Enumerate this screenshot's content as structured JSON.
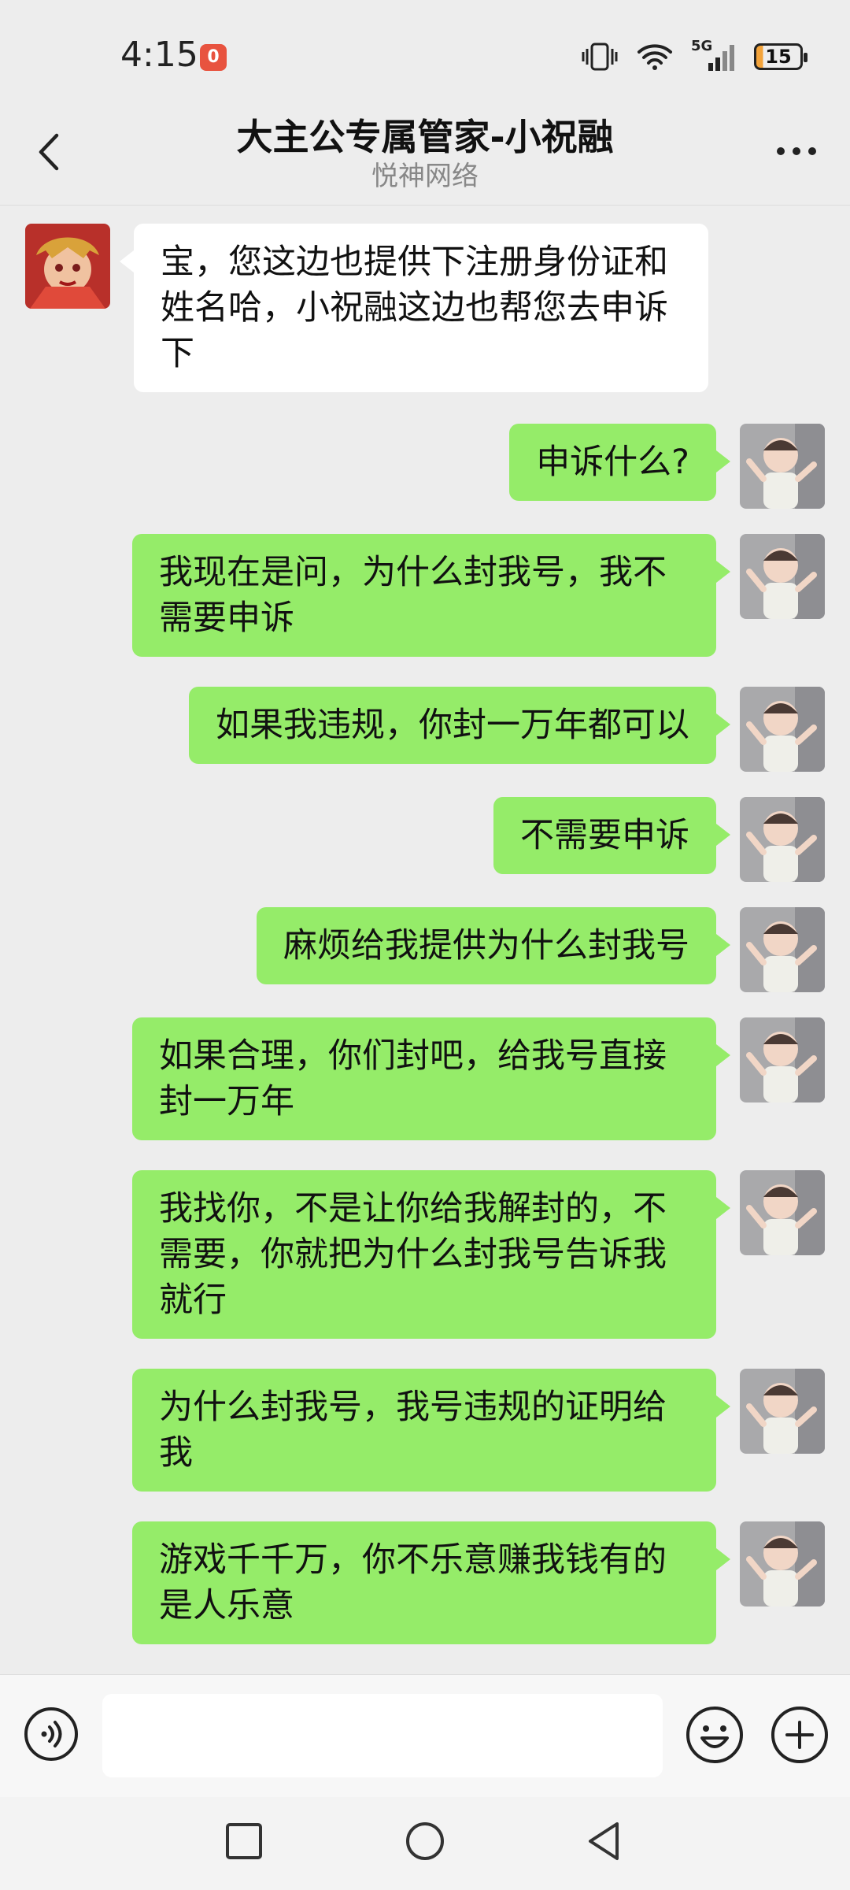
{
  "status_bar": {
    "time": "4:15",
    "notification_badge": "0",
    "signal_label": "5G",
    "battery": "15"
  },
  "header": {
    "title": "大主公专属管家-小祝融",
    "subtitle": "悦神网络"
  },
  "messages": [
    {
      "side": "in",
      "text": "宝，您这边也提供下注册身份证和姓名哈，小祝融这边也帮您去申诉下"
    },
    {
      "side": "out",
      "text": "申诉什么?"
    },
    {
      "side": "out",
      "text": "我现在是问，为什么封我号，我不需要申诉"
    },
    {
      "side": "out",
      "text": "如果我违规，你封一万年都可以"
    },
    {
      "side": "out",
      "text": "不需要申诉"
    },
    {
      "side": "out",
      "text": "麻烦给我提供为什么封我号"
    },
    {
      "side": "out",
      "text": "如果合理，你们封吧，给我号直接封一万年"
    },
    {
      "side": "out",
      "text": "我找你，不是让你给我解封的，不需要，你就把为什么封我号告诉我就行"
    },
    {
      "side": "out",
      "text": "为什么封我号，我号违规的证明给我"
    },
    {
      "side": "out",
      "text": "游戏千千万，你不乐意赚我钱有的是人乐意"
    }
  ],
  "input": {
    "value": ""
  },
  "colors": {
    "outgoing_bubble": "#95ec69",
    "incoming_bubble": "#ffffff",
    "background": "#ededed"
  }
}
